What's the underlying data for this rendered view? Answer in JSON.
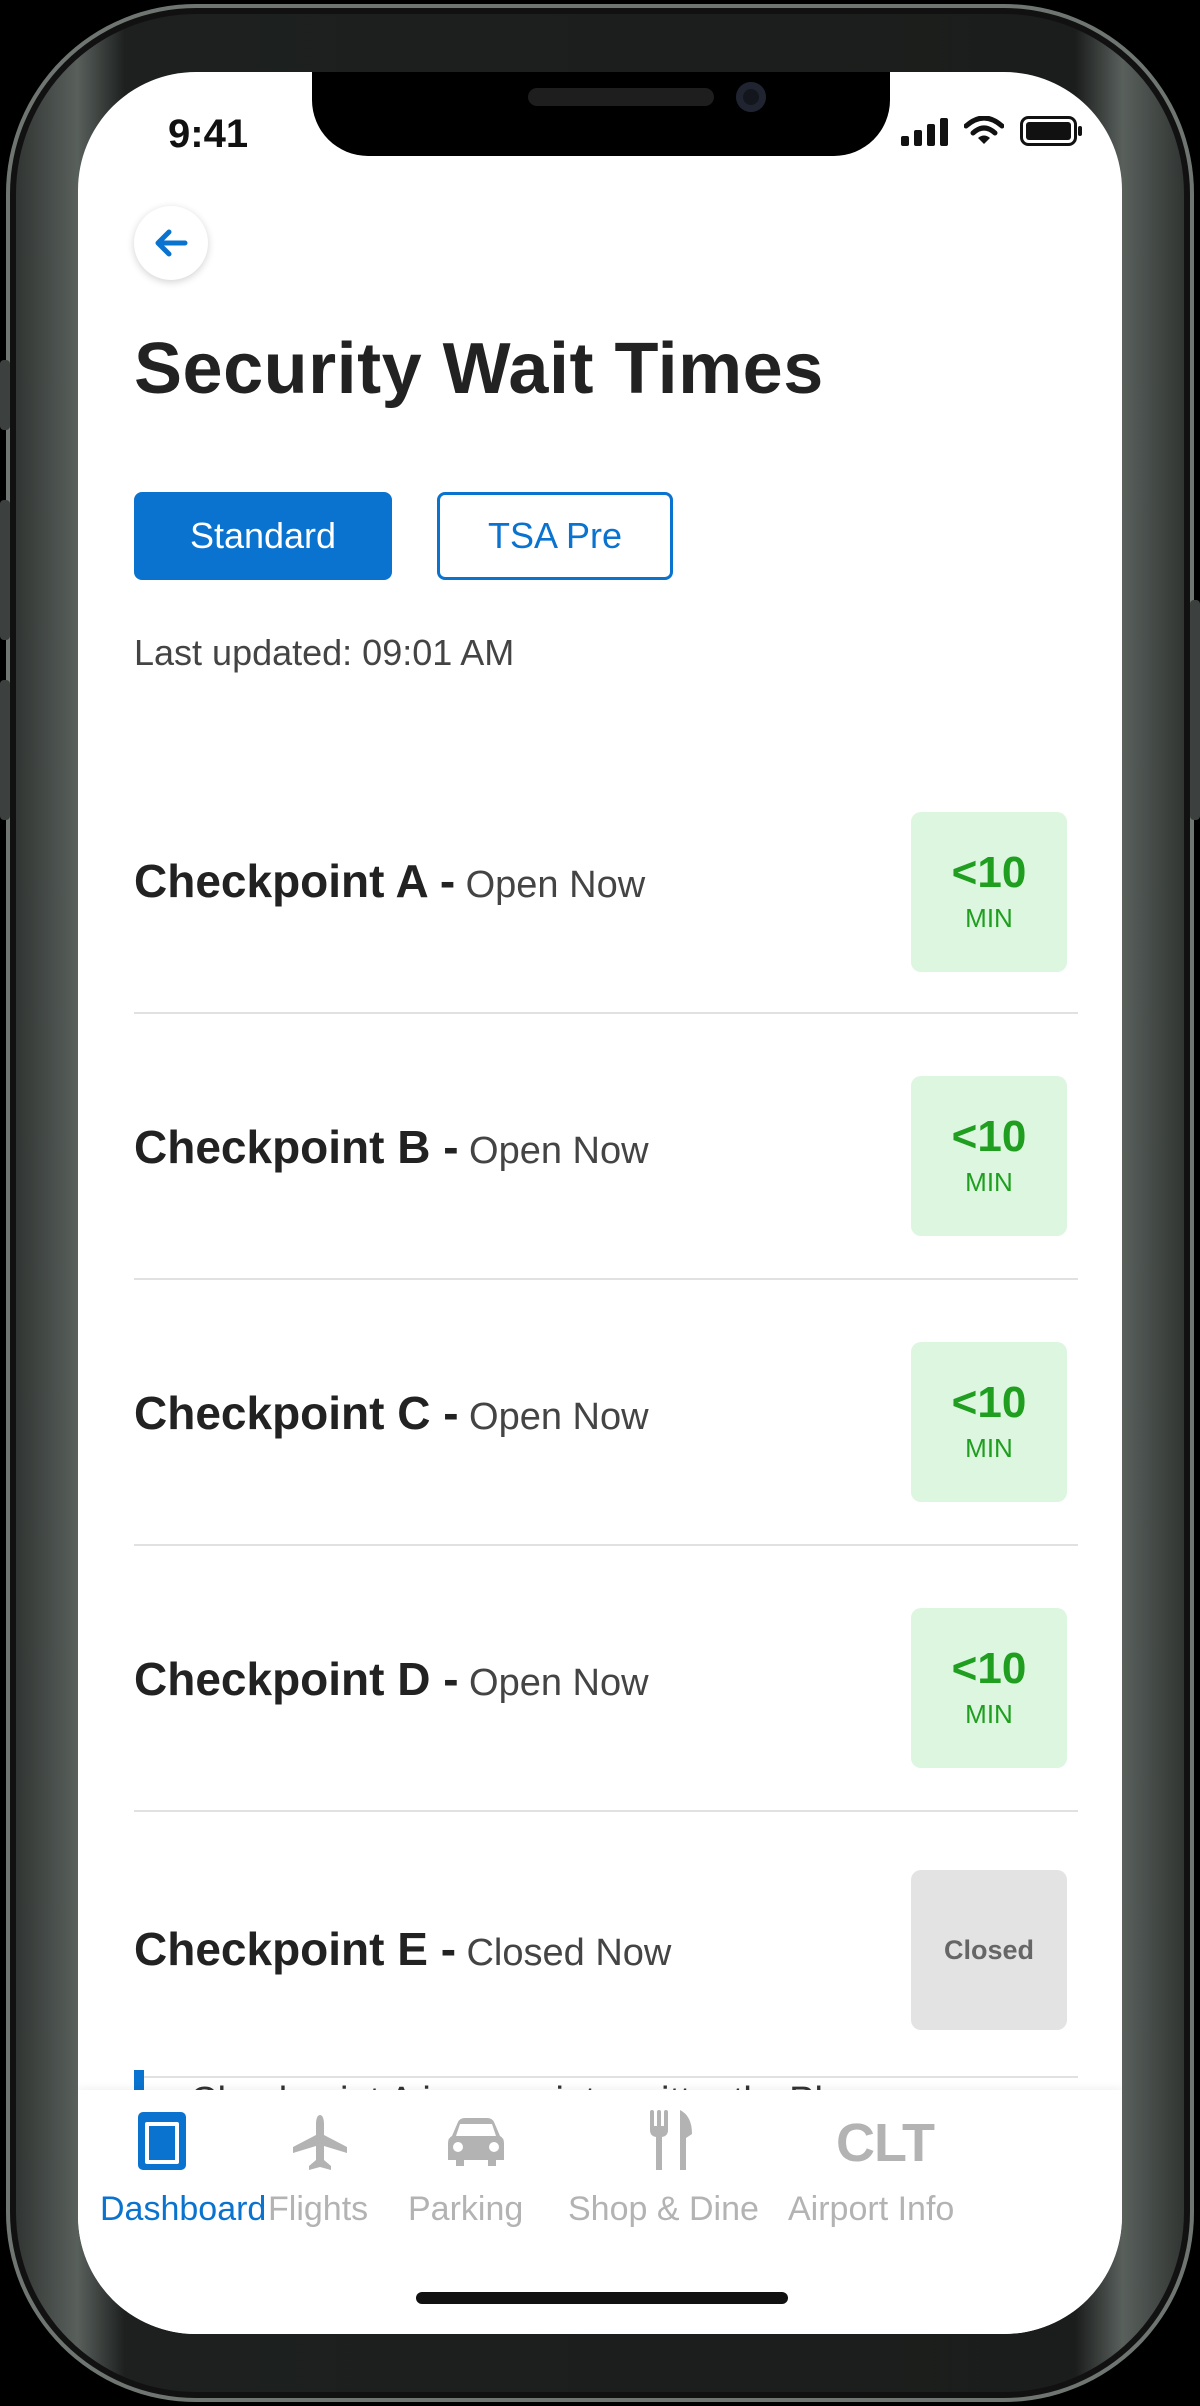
{
  "status_bar": {
    "time": "9:41"
  },
  "header": {
    "title": "Security Wait Times"
  },
  "filters": {
    "standard_label": "Standard",
    "tsa_pre_label": "TSA Pre",
    "selected": "Standard"
  },
  "last_updated": "Last updated: 09:01 AM",
  "checkpoints": [
    {
      "name": "Checkpoint A -",
      "status": "Open Now",
      "wait_value": "<10",
      "wait_unit": "MIN"
    },
    {
      "name": "Checkpoint B -",
      "status": "Open Now",
      "wait_value": "<10",
      "wait_unit": "MIN"
    },
    {
      "name": "Checkpoint C -",
      "status": "Open Now",
      "wait_value": "<10",
      "wait_unit": "MIN"
    },
    {
      "name": "Checkpoint D -",
      "status": "Open Now",
      "wait_value": "<10",
      "wait_unit": "MIN"
    },
    {
      "name": "Checkpoint E -",
      "status": "Closed Now",
      "wait_badge": "Closed"
    }
  ],
  "notice": {
    "text": "Checkpoint A is open intermittently. Please"
  },
  "tab_bar": {
    "tabs": [
      {
        "label": "Dashboard",
        "icon": "dashboard-icon",
        "active": true
      },
      {
        "label": "Flights",
        "icon": "airplane-icon",
        "active": false
      },
      {
        "label": "Parking",
        "icon": "car-icon",
        "active": false
      },
      {
        "label": "Shop & Dine",
        "icon": "fork-knife-icon",
        "active": false
      },
      {
        "label": "Airport Info",
        "icon": "clt-icon",
        "icon_text": "CLT",
        "active": false
      }
    ]
  },
  "colors": {
    "accent": "#0a73cf",
    "open_badge_bg": "#dcf6df",
    "open_badge_text": "#1f9e1f",
    "closed_badge_bg": "#e3e3e3"
  }
}
